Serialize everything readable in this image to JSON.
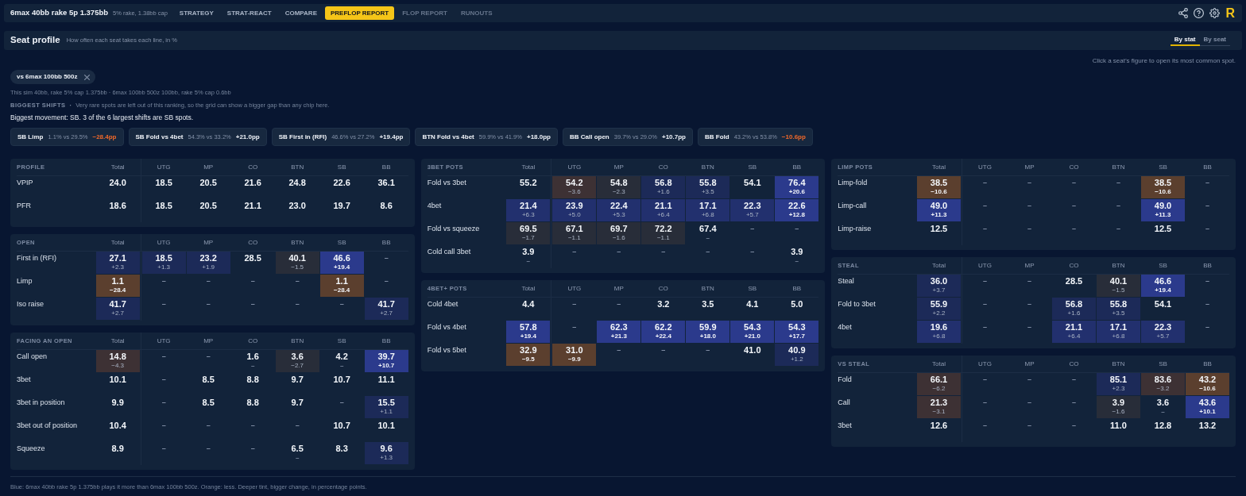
{
  "top_bar": {
    "title": "6max 40bb rake 5p 1.375bb",
    "subtitle": "5% rake, 1.38bb cap",
    "tabs": [
      {
        "label": "STRATEGY",
        "selected": false,
        "disabled": false
      },
      {
        "label": "STRAT-REACT",
        "selected": false,
        "disabled": false
      },
      {
        "label": "COMPARE",
        "selected": false,
        "disabled": false
      },
      {
        "label": "PREFLOP REPORT",
        "selected": true,
        "disabled": false
      },
      {
        "label": "FLOP REPORT",
        "selected": false,
        "disabled": true
      },
      {
        "label": "RUNOUTS",
        "selected": false,
        "disabled": true
      }
    ],
    "logo": "R"
  },
  "header": {
    "title": "Seat profile",
    "subtitle": "How often each seat takes each line, in %",
    "view_toggle": [
      {
        "label": "By stat",
        "selected": true
      },
      {
        "label": "By seat",
        "selected": false
      }
    ]
  },
  "hint": "Click a seat’s figure to open its most common spot.",
  "comparison_chip": {
    "label": "vs 6max 100bb 500z"
  },
  "sim_info": "This sim 40bb, rake 5% cap 1.375bb · 6max 100bb 500z 100bb, rake 5% cap 0.6bb",
  "shifts": {
    "title": "BIGGEST SHIFTS",
    "separator": "·",
    "note": "Very rare spots are left out of this ranking, so the grid can show a bigger gap than any chip here.",
    "summary": "Biggest movement: SB. 3 of the 6 largest shifts are SB spots.",
    "chips": [
      {
        "label": "SB Limp",
        "compare": "1.1% vs 29.5%",
        "shift": "−28.4pp",
        "kind": "loss"
      },
      {
        "label": "SB Fold vs 4bet",
        "compare": "54.3% vs 33.2%",
        "shift": "+21.0pp",
        "kind": "gain"
      },
      {
        "label": "SB First in (RFI)",
        "compare": "46.6% vs 27.2%",
        "shift": "+19.4pp",
        "kind": "gain"
      },
      {
        "label": "BTN Fold vs 4bet",
        "compare": "59.9% vs 41.9%",
        "shift": "+18.0pp",
        "kind": "gain"
      },
      {
        "label": "BB Call open",
        "compare": "39.7% vs 29.0%",
        "shift": "+10.7pp",
        "kind": "gain"
      },
      {
        "label": "BB Fold",
        "compare": "43.2% vs 53.8%",
        "shift": "−10.6pp",
        "kind": "loss"
      }
    ]
  },
  "table_columns": [
    {
      "tables": [
        {
          "title": "PROFILE",
          "columns": [
            "Total",
            "UTG",
            "MP",
            "CO",
            "BTN",
            "SB",
            "BB"
          ],
          "rows": [
            {
              "label": "VPIP",
              "cells": [
                {
                  "kind": "stat",
                  "value": "24.0"
                },
                {
                  "kind": "stat",
                  "value": "18.5"
                },
                {
                  "kind": "stat",
                  "value": "20.5"
                },
                {
                  "kind": "stat",
                  "value": "21.6"
                },
                {
                  "kind": "stat",
                  "value": "24.8"
                },
                {
                  "kind": "stat",
                  "value": "22.6"
                },
                {
                  "kind": "stat",
                  "value": "36.1"
                }
              ]
            },
            {
              "label": "PFR",
              "cells": [
                {
                  "kind": "stat",
                  "value": "18.6"
                },
                {
                  "kind": "stat",
                  "value": "18.5"
                },
                {
                  "kind": "stat",
                  "value": "20.5"
                },
                {
                  "kind": "stat",
                  "value": "21.1"
                },
                {
                  "kind": "stat",
                  "value": "23.0"
                },
                {
                  "kind": "stat",
                  "value": "19.7"
                },
                {
                  "kind": "stat",
                  "value": "8.6"
                }
              ]
            }
          ]
        },
        {
          "title": "OPEN",
          "columns": [
            "Total",
            "UTG",
            "MP",
            "CO",
            "BTN",
            "SB",
            "BB"
          ],
          "rows": [
            {
              "label": "First in (RFI)",
              "cells": [
                {
                  "kind": "stat",
                  "value": "27.1",
                  "delta": "+2.3",
                  "color": "#1c2a58"
                },
                {
                  "kind": "stat",
                  "value": "18.5",
                  "delta": "+1.3",
                  "color": "#1c2a58"
                },
                {
                  "kind": "stat",
                  "value": "23.2",
                  "delta": "+1.9",
                  "color": "#1c2a58"
                },
                {
                  "kind": "stat",
                  "value": "28.5"
                },
                {
                  "kind": "stat",
                  "value": "40.1",
                  "delta": "−1.5",
                  "color": "#282d39"
                },
                {
                  "kind": "stat",
                  "value": "46.6",
                  "delta": "+19.4",
                  "color": "#2b3a8c"
                },
                {
                  "kind": "empty",
                  "value": "–"
                }
              ]
            },
            {
              "label": "Limp",
              "cells": [
                {
                  "kind": "stat",
                  "value": "1.1",
                  "delta": "−28.4",
                  "color": "#5b3f2e"
                },
                {
                  "kind": "empty",
                  "value": "–"
                },
                {
                  "kind": "empty",
                  "value": "–"
                },
                {
                  "kind": "empty",
                  "value": "–"
                },
                {
                  "kind": "empty",
                  "value": "–"
                },
                {
                  "kind": "stat",
                  "value": "1.1",
                  "delta": "−28.4",
                  "color": "#5b3f2e"
                },
                {
                  "kind": "empty",
                  "value": "–"
                }
              ]
            },
            {
              "label": "Iso raise",
              "cells": [
                {
                  "kind": "stat",
                  "value": "41.7",
                  "delta": "+2.7",
                  "color": "#1c2a58"
                },
                {
                  "kind": "empty",
                  "value": "–"
                },
                {
                  "kind": "empty",
                  "value": "–"
                },
                {
                  "kind": "empty",
                  "value": "–"
                },
                {
                  "kind": "empty",
                  "value": "–"
                },
                {
                  "kind": "empty",
                  "value": "–"
                },
                {
                  "kind": "stat",
                  "value": "41.7",
                  "delta": "+2.7",
                  "color": "#1c2a58"
                }
              ]
            }
          ]
        },
        {
          "title": "FACING AN OPEN",
          "columns": [
            "Total",
            "UTG",
            "MP",
            "CO",
            "BTN",
            "SB",
            "BB"
          ],
          "rows": [
            {
              "label": "Call open",
              "cells": [
                {
                  "kind": "stat",
                  "value": "14.8",
                  "delta": "−4.3",
                  "color": "#3d3134"
                },
                {
                  "kind": "empty",
                  "value": "–"
                },
                {
                  "kind": "empty",
                  "value": "–"
                },
                {
                  "kind": "stat",
                  "value": "1.6",
                  "delta": "–"
                },
                {
                  "kind": "stat",
                  "value": "3.6",
                  "delta": "−2.7",
                  "color": "#282d39"
                },
                {
                  "kind": "stat",
                  "value": "4.2",
                  "delta": "–"
                },
                {
                  "kind": "stat",
                  "value": "39.7",
                  "delta": "+10.7",
                  "color": "#2b3a8c"
                }
              ]
            },
            {
              "label": "3bet",
              "cells": [
                {
                  "kind": "stat",
                  "value": "10.1"
                },
                {
                  "kind": "empty",
                  "value": "–"
                },
                {
                  "kind": "stat",
                  "value": "8.5"
                },
                {
                  "kind": "stat",
                  "value": "8.8"
                },
                {
                  "kind": "stat",
                  "value": "9.7"
                },
                {
                  "kind": "stat",
                  "value": "10.7"
                },
                {
                  "kind": "stat",
                  "value": "11.1"
                }
              ]
            },
            {
              "label": "3bet in position",
              "cells": [
                {
                  "kind": "stat",
                  "value": "9.9"
                },
                {
                  "kind": "empty",
                  "value": "–"
                },
                {
                  "kind": "stat",
                  "value": "8.5"
                },
                {
                  "kind": "stat",
                  "value": "8.8"
                },
                {
                  "kind": "stat",
                  "value": "9.7"
                },
                {
                  "kind": "empty",
                  "value": "–"
                },
                {
                  "kind": "stat",
                  "value": "15.5",
                  "delta": "+1.1",
                  "color": "#1c2a58"
                }
              ]
            },
            {
              "label": "3bet out of position",
              "cells": [
                {
                  "kind": "stat",
                  "value": "10.4"
                },
                {
                  "kind": "empty",
                  "value": "–"
                },
                {
                  "kind": "empty",
                  "value": "–"
                },
                {
                  "kind": "empty",
                  "value": "–"
                },
                {
                  "kind": "empty",
                  "value": "–"
                },
                {
                  "kind": "stat",
                  "value": "10.7"
                },
                {
                  "kind": "stat",
                  "value": "10.1"
                }
              ]
            },
            {
              "label": "Squeeze",
              "cells": [
                {
                  "kind": "stat",
                  "value": "8.9"
                },
                {
                  "kind": "empty",
                  "value": "–"
                },
                {
                  "kind": "empty",
                  "value": "–"
                },
                {
                  "kind": "empty",
                  "value": "–"
                },
                {
                  "kind": "stat",
                  "value": "6.5",
                  "delta": "–"
                },
                {
                  "kind": "stat",
                  "value": "8.3"
                },
                {
                  "kind": "stat",
                  "value": "9.6",
                  "delta": "+1.3",
                  "color": "#1c2a58"
                }
              ]
            }
          ]
        }
      ]
    },
    {
      "tables": [
        {
          "title": "3BET POTS",
          "columns": [
            "Total",
            "UTG",
            "MP",
            "CO",
            "BTN",
            "SB",
            "BB"
          ],
          "rows": [
            {
              "label": "Fold vs 3bet",
              "cells": [
                {
                  "kind": "stat",
                  "value": "55.2"
                },
                {
                  "kind": "stat",
                  "value": "54.2",
                  "delta": "−3.6",
                  "color": "#3d3134"
                },
                {
                  "kind": "stat",
                  "value": "54.8",
                  "delta": "−2.3",
                  "color": "#282d39"
                },
                {
                  "kind": "stat",
                  "value": "56.8",
                  "delta": "+1.6",
                  "color": "#1c2a58"
                },
                {
                  "kind": "stat",
                  "value": "55.8",
                  "delta": "+3.5",
                  "color": "#1c2a58"
                },
                {
                  "kind": "stat",
                  "value": "54.1"
                },
                {
                  "kind": "stat",
                  "value": "76.4",
                  "delta": "+20.6",
                  "color": "#2b3a8c"
                }
              ]
            },
            {
              "label": "4bet",
              "cells": [
                {
                  "kind": "stat",
                  "value": "21.4",
                  "delta": "+6.3",
                  "color": "#22306e"
                },
                {
                  "kind": "stat",
                  "value": "23.9",
                  "delta": "+5.0",
                  "color": "#22306e"
                },
                {
                  "kind": "stat",
                  "value": "22.4",
                  "delta": "+5.3",
                  "color": "#22306e"
                },
                {
                  "kind": "stat",
                  "value": "21.1",
                  "delta": "+6.4",
                  "color": "#22306e"
                },
                {
                  "kind": "stat",
                  "value": "17.1",
                  "delta": "+6.8",
                  "color": "#22306e"
                },
                {
                  "kind": "stat",
                  "value": "22.3",
                  "delta": "+5.7",
                  "color": "#22306e"
                },
                {
                  "kind": "stat",
                  "value": "22.6",
                  "delta": "+12.8",
                  "color": "#2b3a8c"
                }
              ]
            },
            {
              "label": "Fold vs squeeze",
              "cells": [
                {
                  "kind": "stat",
                  "value": "69.5",
                  "delta": "−1.7",
                  "color": "#282d39"
                },
                {
                  "kind": "stat",
                  "value": "67.1",
                  "delta": "−1.1",
                  "color": "#282d39"
                },
                {
                  "kind": "stat",
                  "value": "69.7",
                  "delta": "−1.6",
                  "color": "#282d39"
                },
                {
                  "kind": "stat",
                  "value": "72.2",
                  "delta": "−1.1",
                  "color": "#282d39"
                },
                {
                  "kind": "stat",
                  "value": "67.4",
                  "delta": "–"
                },
                {
                  "kind": "empty",
                  "value": "–"
                },
                {
                  "kind": "empty",
                  "value": "–"
                }
              ]
            },
            {
              "label": "Cold call 3bet",
              "cells": [
                {
                  "kind": "stat",
                  "value": "3.9",
                  "delta": "–"
                },
                {
                  "kind": "empty",
                  "value": "–"
                },
                {
                  "kind": "empty",
                  "value": "–"
                },
                {
                  "kind": "empty",
                  "value": "–"
                },
                {
                  "kind": "empty",
                  "value": "–"
                },
                {
                  "kind": "empty",
                  "value": "–"
                },
                {
                  "kind": "stat",
                  "value": "3.9",
                  "delta": "–"
                }
              ]
            }
          ]
        },
        {
          "title": "4BET+ POTS",
          "columns": [
            "Total",
            "UTG",
            "MP",
            "CO",
            "BTN",
            "SB",
            "BB"
          ],
          "rows": [
            {
              "label": "Cold 4bet",
              "cells": [
                {
                  "kind": "stat",
                  "value": "4.4"
                },
                {
                  "kind": "empty",
                  "value": "–"
                },
                {
                  "kind": "empty",
                  "value": "–"
                },
                {
                  "kind": "stat",
                  "value": "3.2"
                },
                {
                  "kind": "stat",
                  "value": "3.5"
                },
                {
                  "kind": "stat",
                  "value": "4.1"
                },
                {
                  "kind": "stat",
                  "value": "5.0"
                }
              ]
            },
            {
              "label": "Fold vs 4bet",
              "cells": [
                {
                  "kind": "stat",
                  "value": "57.8",
                  "delta": "+19.4",
                  "color": "#2b3a8c"
                },
                {
                  "kind": "empty",
                  "value": "–"
                },
                {
                  "kind": "stat",
                  "value": "62.3",
                  "delta": "+21.3",
                  "color": "#2b3a8c"
                },
                {
                  "kind": "stat",
                  "value": "62.2",
                  "delta": "+22.4",
                  "color": "#2b3a8c"
                },
                {
                  "kind": "stat",
                  "value": "59.9",
                  "delta": "+18.0",
                  "color": "#2b3a8c"
                },
                {
                  "kind": "stat",
                  "value": "54.3",
                  "delta": "+21.0",
                  "color": "#2b3a8c"
                },
                {
                  "kind": "stat",
                  "value": "54.3",
                  "delta": "+17.7",
                  "color": "#2b3a8c"
                }
              ]
            },
            {
              "label": "Fold vs 5bet",
              "cells": [
                {
                  "kind": "stat",
                  "value": "32.9",
                  "delta": "−9.5",
                  "color": "#5b3f2e"
                },
                {
                  "kind": "stat",
                  "value": "31.0",
                  "delta": "−9.9",
                  "color": "#5b3f2e"
                },
                {
                  "kind": "empty",
                  "value": "–"
                },
                {
                  "kind": "empty",
                  "value": "–"
                },
                {
                  "kind": "empty",
                  "value": "–"
                },
                {
                  "kind": "stat",
                  "value": "41.0"
                },
                {
                  "kind": "stat",
                  "value": "40.9",
                  "delta": "+1.2",
                  "color": "#1c2a58"
                }
              ]
            }
          ]
        }
      ]
    },
    {
      "tables": [
        {
          "title": "LIMP POTS",
          "columns": [
            "Total",
            "UTG",
            "MP",
            "CO",
            "BTN",
            "SB",
            "BB"
          ],
          "rows": [
            {
              "label": "Limp-fold",
              "cells": [
                {
                  "kind": "stat",
                  "value": "38.5",
                  "delta": "−10.6",
                  "color": "#5b3f2e"
                },
                {
                  "kind": "empty",
                  "value": "–"
                },
                {
                  "kind": "empty",
                  "value": "–"
                },
                {
                  "kind": "empty",
                  "value": "–"
                },
                {
                  "kind": "empty",
                  "value": "–"
                },
                {
                  "kind": "stat",
                  "value": "38.5",
                  "delta": "−10.6",
                  "color": "#5b3f2e"
                },
                {
                  "kind": "empty",
                  "value": "–"
                }
              ]
            },
            {
              "label": "Limp-call",
              "cells": [
                {
                  "kind": "stat",
                  "value": "49.0",
                  "delta": "+11.3",
                  "color": "#2b3a8c"
                },
                {
                  "kind": "empty",
                  "value": "–"
                },
                {
                  "kind": "empty",
                  "value": "–"
                },
                {
                  "kind": "empty",
                  "value": "–"
                },
                {
                  "kind": "empty",
                  "value": "–"
                },
                {
                  "kind": "stat",
                  "value": "49.0",
                  "delta": "+11.3",
                  "color": "#2b3a8c"
                },
                {
                  "kind": "empty",
                  "value": "–"
                }
              ]
            },
            {
              "label": "Limp-raise",
              "cells": [
                {
                  "kind": "stat",
                  "value": "12.5"
                },
                {
                  "kind": "empty",
                  "value": "–"
                },
                {
                  "kind": "empty",
                  "value": "–"
                },
                {
                  "kind": "empty",
                  "value": "–"
                },
                {
                  "kind": "empty",
                  "value": "–"
                },
                {
                  "kind": "stat",
                  "value": "12.5"
                },
                {
                  "kind": "empty",
                  "value": "–"
                }
              ]
            }
          ]
        },
        {
          "title": "STEAL",
          "columns": [
            "Total",
            "UTG",
            "MP",
            "CO",
            "BTN",
            "SB",
            "BB"
          ],
          "rows": [
            {
              "label": "Steal",
              "cells": [
                {
                  "kind": "stat",
                  "value": "36.0",
                  "delta": "+3.7",
                  "color": "#1c2a58"
                },
                {
                  "kind": "empty",
                  "value": "–"
                },
                {
                  "kind": "empty",
                  "value": "–"
                },
                {
                  "kind": "stat",
                  "value": "28.5"
                },
                {
                  "kind": "stat",
                  "value": "40.1",
                  "delta": "−1.5",
                  "color": "#282d39"
                },
                {
                  "kind": "stat",
                  "value": "46.6",
                  "delta": "+19.4",
                  "color": "#2b3a8c"
                },
                {
                  "kind": "empty",
                  "value": "–"
                }
              ]
            },
            {
              "label": "Fold to 3bet",
              "cells": [
                {
                  "kind": "stat",
                  "value": "55.9",
                  "delta": "+2.2",
                  "color": "#1c2a58"
                },
                {
                  "kind": "empty",
                  "value": "–"
                },
                {
                  "kind": "empty",
                  "value": "–"
                },
                {
                  "kind": "stat",
                  "value": "56.8",
                  "delta": "+1.6",
                  "color": "#1c2a58"
                },
                {
                  "kind": "stat",
                  "value": "55.8",
                  "delta": "+3.5",
                  "color": "#1c2a58"
                },
                {
                  "kind": "stat",
                  "value": "54.1"
                },
                {
                  "kind": "empty",
                  "value": "–"
                }
              ]
            },
            {
              "label": "4bet",
              "cells": [
                {
                  "kind": "stat",
                  "value": "19.6",
                  "delta": "+6.8",
                  "color": "#22306e"
                },
                {
                  "kind": "empty",
                  "value": "–"
                },
                {
                  "kind": "empty",
                  "value": "–"
                },
                {
                  "kind": "stat",
                  "value": "21.1",
                  "delta": "+6.4",
                  "color": "#22306e"
                },
                {
                  "kind": "stat",
                  "value": "17.1",
                  "delta": "+6.8",
                  "color": "#22306e"
                },
                {
                  "kind": "stat",
                  "value": "22.3",
                  "delta": "+5.7",
                  "color": "#22306e"
                },
                {
                  "kind": "empty",
                  "value": "–"
                }
              ]
            }
          ]
        },
        {
          "title": "VS STEAL",
          "columns": [
            "Total",
            "UTG",
            "MP",
            "CO",
            "BTN",
            "SB",
            "BB"
          ],
          "rows": [
            {
              "label": "Fold",
              "cells": [
                {
                  "kind": "stat",
                  "value": "66.1",
                  "delta": "−6.2",
                  "color": "#3d3134"
                },
                {
                  "kind": "empty",
                  "value": "–"
                },
                {
                  "kind": "empty",
                  "value": "–"
                },
                {
                  "kind": "empty",
                  "value": "–"
                },
                {
                  "kind": "stat",
                  "value": "85.1",
                  "delta": "+2.3",
                  "color": "#1c2a58"
                },
                {
                  "kind": "stat",
                  "value": "83.6",
                  "delta": "−3.2",
                  "color": "#3d3134"
                },
                {
                  "kind": "stat",
                  "value": "43.2",
                  "delta": "−10.6",
                  "color": "#5b3f2e"
                }
              ]
            },
            {
              "label": "Call",
              "cells": [
                {
                  "kind": "stat",
                  "value": "21.3",
                  "delta": "−3.1",
                  "color": "#3d3134"
                },
                {
                  "kind": "empty",
                  "value": "–"
                },
                {
                  "kind": "empty",
                  "value": "–"
                },
                {
                  "kind": "empty",
                  "value": "–"
                },
                {
                  "kind": "stat",
                  "value": "3.9",
                  "delta": "−1.6",
                  "color": "#282d39"
                },
                {
                  "kind": "stat",
                  "value": "3.6",
                  "delta": "–"
                },
                {
                  "kind": "stat",
                  "value": "43.6",
                  "delta": "+10.1",
                  "color": "#2b3a8c"
                }
              ]
            },
            {
              "label": "3bet",
              "cells": [
                {
                  "kind": "stat",
                  "value": "12.6"
                },
                {
                  "kind": "empty",
                  "value": "–"
                },
                {
                  "kind": "empty",
                  "value": "–"
                },
                {
                  "kind": "empty",
                  "value": "–"
                },
                {
                  "kind": "stat",
                  "value": "11.0"
                },
                {
                  "kind": "stat",
                  "value": "12.8"
                },
                {
                  "kind": "stat",
                  "value": "13.2"
                }
              ]
            }
          ]
        }
      ]
    }
  ],
  "footer": "Blue: 6max 40bb rake 5p 1.375bb plays it more than 6max 100bb 500z. Orange: less. Deeper tint, bigger change, in percentage points."
}
